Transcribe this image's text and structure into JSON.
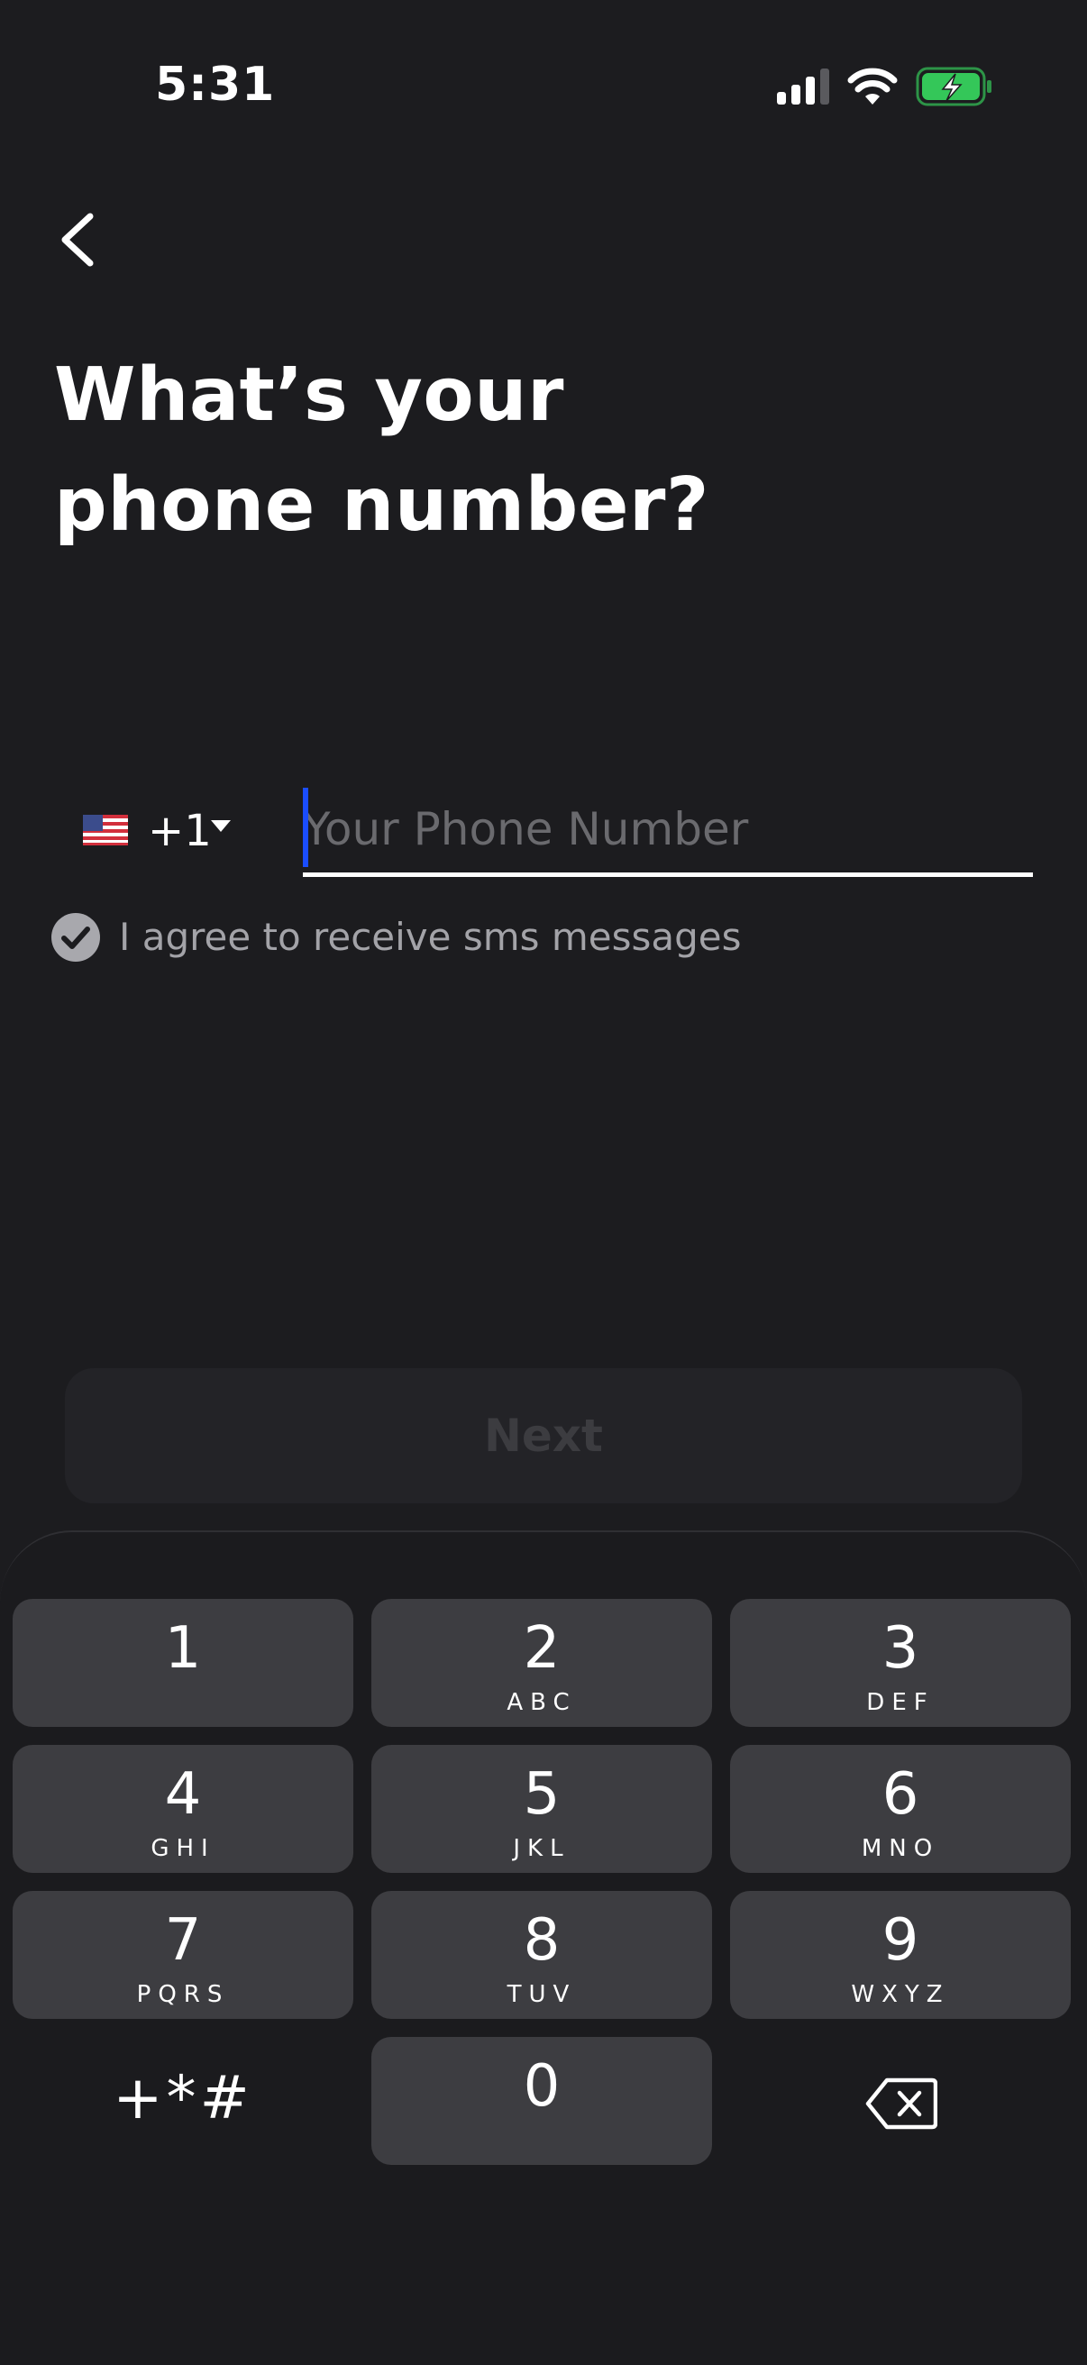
{
  "status_bar": {
    "time": "5:31",
    "icons": [
      "signal-icon",
      "wifi-icon",
      "battery-charging-icon"
    ],
    "battery_color": "#34c759"
  },
  "header": {
    "back_icon": "chevron-left-icon",
    "title_line1": "What’s your",
    "title_line2": "phone number?"
  },
  "phone_form": {
    "country_flag": "🇺🇸",
    "country_code": "+1",
    "phone_value": "",
    "phone_placeholder": "Your Phone Number",
    "caret_color": "#1a4dff",
    "agree_checked": true,
    "agree_label": "I agree to receive sms messages"
  },
  "next_button": {
    "label": "Next",
    "enabled": false
  },
  "keypad": {
    "keys": [
      {
        "digit": "1",
        "letters": ""
      },
      {
        "digit": "2",
        "letters": "ABC"
      },
      {
        "digit": "3",
        "letters": "DEF"
      },
      {
        "digit": "4",
        "letters": "GHI"
      },
      {
        "digit": "5",
        "letters": "JKL"
      },
      {
        "digit": "6",
        "letters": "MNO"
      },
      {
        "digit": "7",
        "letters": "PQRS"
      },
      {
        "digit": "8",
        "letters": "TUV"
      },
      {
        "digit": "9",
        "letters": "WXYZ"
      },
      {
        "digit": "0",
        "letters": ""
      }
    ],
    "symbols_label": "+*#",
    "delete_icon": "backspace-icon"
  }
}
